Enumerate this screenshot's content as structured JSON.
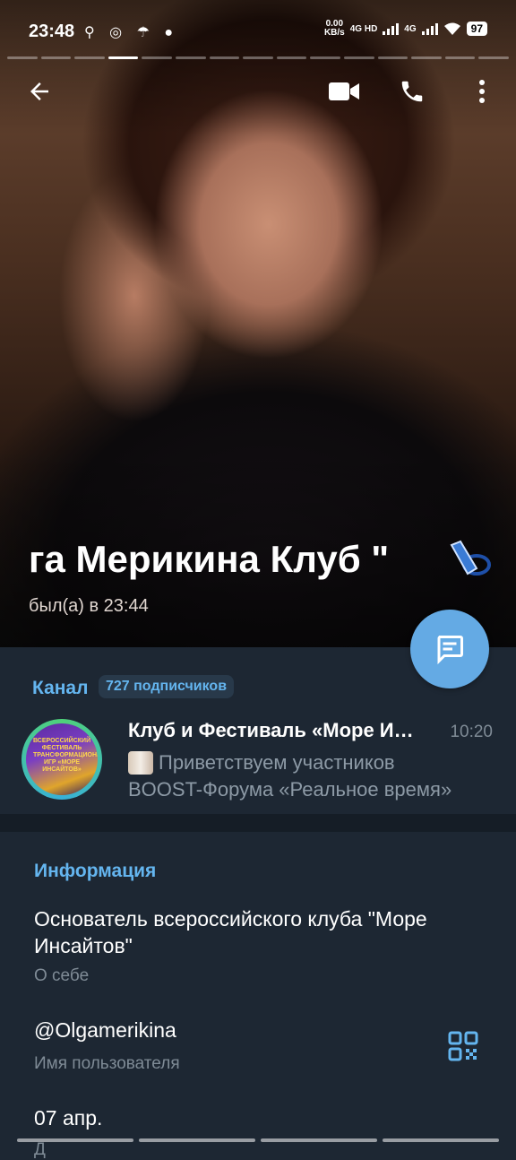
{
  "status_bar": {
    "time": "23:48",
    "speed_value": "0.00",
    "speed_unit": "KB/s",
    "net1": "4G HD",
    "net2": "4G",
    "battery": "97"
  },
  "header": {
    "name": "га Мерикина Клуб \"",
    "last_seen": "был(а) в 23:44"
  },
  "channel": {
    "label": "Канал",
    "subscribers": "727 подписчиков",
    "title": "Клуб и Фестиваль «Море Инсайтов»",
    "time": "10:20",
    "message_line1": "Приветствуем участников",
    "message_line2": "BOOST-Форума «Реальное время»",
    "avatar_text": "ВСЕРОССИЙСКИЙ ФЕСТИВАЛЬ ТРАНСФОРМАЦИОННЫХ ИГР «МОРЕ ИНСАЙТОВ»"
  },
  "info": {
    "heading": "Информация",
    "bio": "Основатель всероссийского клуба \"Море Инсайтов\"",
    "bio_label": "О себе",
    "username": "@Olgamerikina",
    "username_label": "Имя пользователя",
    "birthday": "07 апр.",
    "birthday_label": "Д"
  },
  "colors": {
    "accent": "#64b5ef",
    "fab": "#64aae4",
    "background": "#1d2733",
    "secondary_text": "#7f8b96"
  },
  "icons": [
    "back-arrow-icon",
    "video-call-icon",
    "phone-icon",
    "more-vertical-icon",
    "message-icon",
    "qr-code-icon"
  ]
}
